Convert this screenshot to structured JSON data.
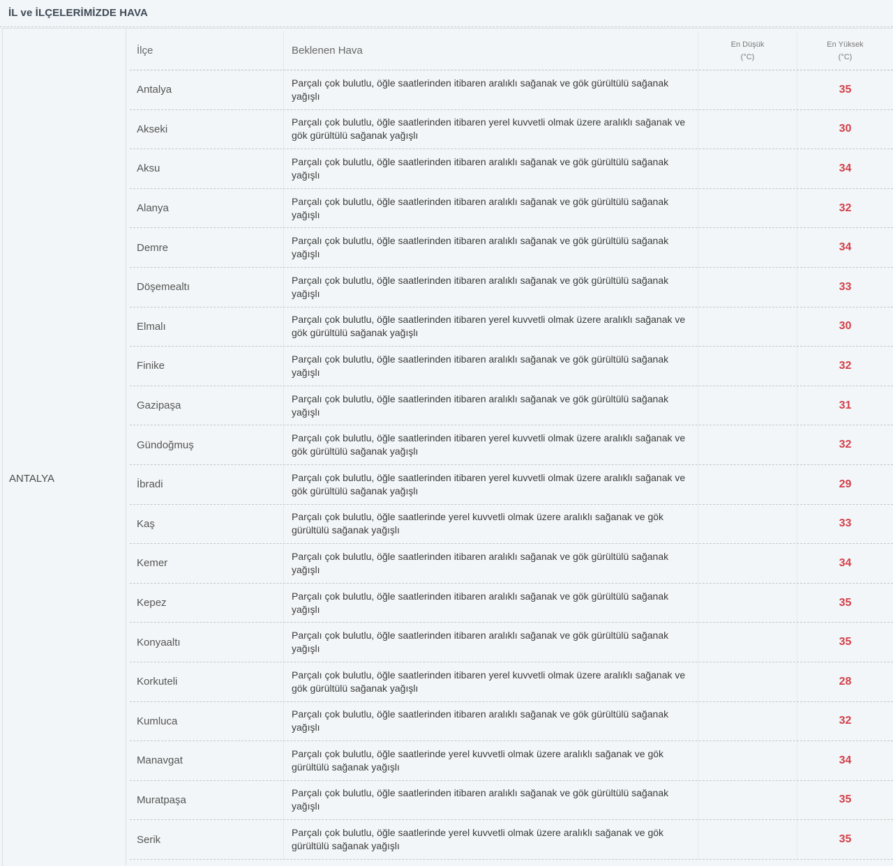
{
  "page": {
    "title": "İL ve İLÇELERİMİZDE HAVA"
  },
  "city": "ANTALYA",
  "headers": {
    "ilce": "İlçe",
    "hava": "Beklenen Hava",
    "low_line1": "En Düşük",
    "low_line2": "(°C)",
    "high_line1": "En Yüksek",
    "high_line2": "(°C)"
  },
  "colors": {
    "high_temp": "#d3404a",
    "title": "#3e4a57",
    "background": "#f3f6f8"
  },
  "rows": [
    {
      "ilce": "Antalya",
      "hava": "Parçalı çok bulutlu, öğle saatlerinden itibaren aralıklı sağanak ve gök gürültülü sağanak yağışlı",
      "low": "",
      "high": "35"
    },
    {
      "ilce": "Akseki",
      "hava": "Parçalı çok bulutlu, öğle saatlerinden itibaren yerel kuvvetli olmak üzere aralıklı sağanak ve gök gürültülü sağanak yağışlı",
      "low": "",
      "high": "30"
    },
    {
      "ilce": "Aksu",
      "hava": "Parçalı çok bulutlu, öğle saatlerinden itibaren aralıklı sağanak ve gök gürültülü sağanak yağışlı",
      "low": "",
      "high": "34"
    },
    {
      "ilce": "Alanya",
      "hava": "Parçalı çok bulutlu, öğle saatlerinden itibaren aralıklı sağanak ve gök gürültülü sağanak yağışlı",
      "low": "",
      "high": "32"
    },
    {
      "ilce": "Demre",
      "hava": "Parçalı çok bulutlu, öğle saatlerinden itibaren aralıklı sağanak ve gök gürültülü sağanak yağışlı",
      "low": "",
      "high": "34"
    },
    {
      "ilce": "Döşemealtı",
      "hava": "Parçalı çok bulutlu, öğle saatlerinden itibaren aralıklı sağanak ve gök gürültülü sağanak yağışlı",
      "low": "",
      "high": "33"
    },
    {
      "ilce": "Elmalı",
      "hava": "Parçalı çok bulutlu, öğle saatlerinden itibaren yerel kuvvetli olmak üzere aralıklı sağanak ve gök gürültülü sağanak yağışlı",
      "low": "",
      "high": "30"
    },
    {
      "ilce": "Finike",
      "hava": "Parçalı çok bulutlu, öğle saatlerinden itibaren aralıklı sağanak ve gök gürültülü sağanak yağışlı",
      "low": "",
      "high": "32"
    },
    {
      "ilce": "Gazipaşa",
      "hava": "Parçalı çok bulutlu, öğle saatlerinden itibaren aralıklı sağanak ve gök gürültülü sağanak yağışlı",
      "low": "",
      "high": "31"
    },
    {
      "ilce": "Gündoğmuş",
      "hava": "Parçalı çok bulutlu, öğle saatlerinden itibaren yerel kuvvetli olmak üzere aralıklı sağanak ve gök gürültülü sağanak yağışlı",
      "low": "",
      "high": "32"
    },
    {
      "ilce": "İbradi",
      "hava": "Parçalı çok bulutlu, öğle saatlerinden itibaren yerel kuvvetli olmak üzere aralıklı sağanak ve gök gürültülü sağanak yağışlı",
      "low": "",
      "high": "29"
    },
    {
      "ilce": "Kaş",
      "hava": "Parçalı çok bulutlu, öğle saatlerinde yerel kuvvetli olmak üzere aralıklı sağanak ve gök gürültülü sağanak yağışlı",
      "low": "",
      "high": "33"
    },
    {
      "ilce": "Kemer",
      "hava": "Parçalı çok bulutlu, öğle saatlerinden itibaren aralıklı sağanak ve gök gürültülü sağanak yağışlı",
      "low": "",
      "high": "34"
    },
    {
      "ilce": "Kepez",
      "hava": "Parçalı çok bulutlu, öğle saatlerinden itibaren aralıklı sağanak ve gök gürültülü sağanak yağışlı",
      "low": "",
      "high": "35"
    },
    {
      "ilce": "Konyaaltı",
      "hava": "Parçalı çok bulutlu, öğle saatlerinden itibaren aralıklı sağanak ve gök gürültülü sağanak yağışlı",
      "low": "",
      "high": "35"
    },
    {
      "ilce": "Korkuteli",
      "hava": "Parçalı çok bulutlu, öğle saatlerinden itibaren yerel kuvvetli olmak üzere aralıklı sağanak ve gök gürültülü sağanak yağışlı",
      "low": "",
      "high": "28"
    },
    {
      "ilce": "Kumluca",
      "hava": "Parçalı çok bulutlu, öğle saatlerinden itibaren aralıklı sağanak ve gök gürültülü sağanak yağışlı",
      "low": "",
      "high": "32"
    },
    {
      "ilce": "Manavgat",
      "hava": "Parçalı çok bulutlu, öğle saatlerinde yerel kuvvetli olmak üzere aralıklı sağanak ve gök gürültülü sağanak yağışlı",
      "low": "",
      "high": "34"
    },
    {
      "ilce": "Muratpaşa",
      "hava": "Parçalı çok bulutlu, öğle saatlerinden itibaren aralıklı sağanak ve gök gürültülü sağanak yağışlı",
      "low": "",
      "high": "35"
    },
    {
      "ilce": "Serik",
      "hava": "Parçalı çok bulutlu, öğle saatlerinde yerel kuvvetli olmak üzere aralıklı sağanak ve gök gürültülü sağanak yağışlı",
      "low": "",
      "high": "35"
    }
  ]
}
